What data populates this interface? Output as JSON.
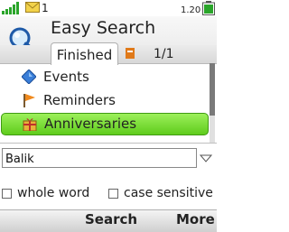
{
  "status_bar": {
    "clock": "1.20",
    "bluetooth_indicator": "1"
  },
  "app": {
    "title": "Easy Search"
  },
  "tabs": {
    "active_label": "Finished",
    "page_indicator": "1/1"
  },
  "categories": [
    {
      "label": "Events",
      "icon": "diamond-icon"
    },
    {
      "label": "Reminders",
      "icon": "flag-icon"
    },
    {
      "label": "Anniversaries",
      "icon": "gift-icon",
      "selected": true
    }
  ],
  "search": {
    "value": "Balik"
  },
  "options": {
    "whole_word_label": "whole word",
    "whole_word_checked": false,
    "case_sensitive_label": "case sensitive",
    "case_sensitive_checked": false
  },
  "softkeys": {
    "center": "Search",
    "right": "More"
  },
  "colors": {
    "selection": "#7ddf3a",
    "signal": "#2aa52a"
  }
}
